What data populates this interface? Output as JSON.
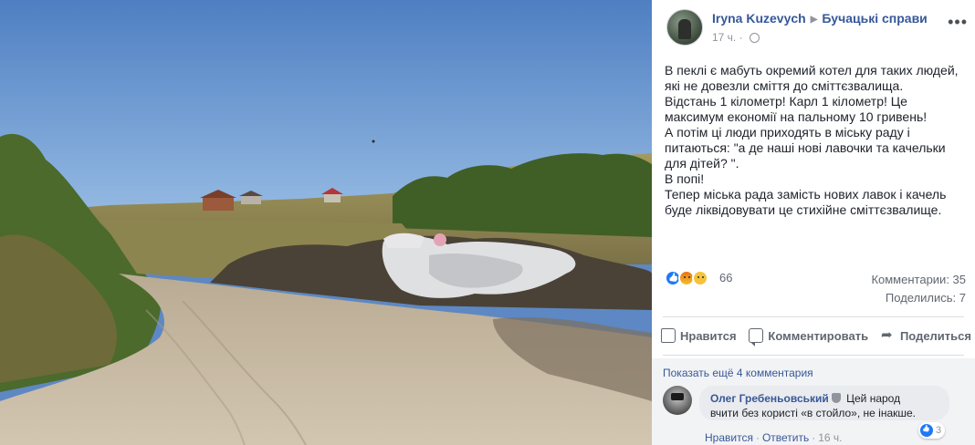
{
  "post": {
    "author": "Iryna Kuzevych",
    "group": "Бучацькі справи",
    "time": "17 ч.",
    "text_lines": [
      "В пеклі є мабуть окремий котел для таких людей,",
      "які не довезли сміття до сміттєзвалища.",
      "Відстань 1 кілометр! Карл 1 кілометр! Це",
      "максимум економії на пальному 10 гривень!",
      "А потім ці люди приходять в міську раду і",
      "питаються: \"а де наші нові лавочки та качельки",
      "для дітей? \".",
      "В попі!",
      "Тепер міська рада замість нових лавок і качель",
      "буде ліквідовувати це стихійне сміттєзвалище."
    ]
  },
  "stats": {
    "reaction_count": "66",
    "comments": "Комментарии: 35",
    "shares": "Поделились: 7"
  },
  "actions": {
    "like": "Нравится",
    "comment": "Комментировать",
    "share": "Поделиться"
  },
  "comments": {
    "show_more": "Показать ещё 4 комментария",
    "items": [
      {
        "name": "Олег Гребеньовський",
        "text_line1": " Цей народ",
        "text_line2": "вчити без користі «в стойло», не інакше.",
        "reaction_count": "3",
        "like": "Нравится",
        "reply": "Ответить",
        "time": "16 ч."
      }
    ]
  },
  "icons": {
    "post_reactions": [
      "like-icon",
      "angry-icon",
      "sad-icon"
    ],
    "more": "more-icon",
    "privacy": "globe-icon"
  },
  "colors": {
    "link": "#365899",
    "like": "#2078f4",
    "secondary": "#90949c"
  }
}
